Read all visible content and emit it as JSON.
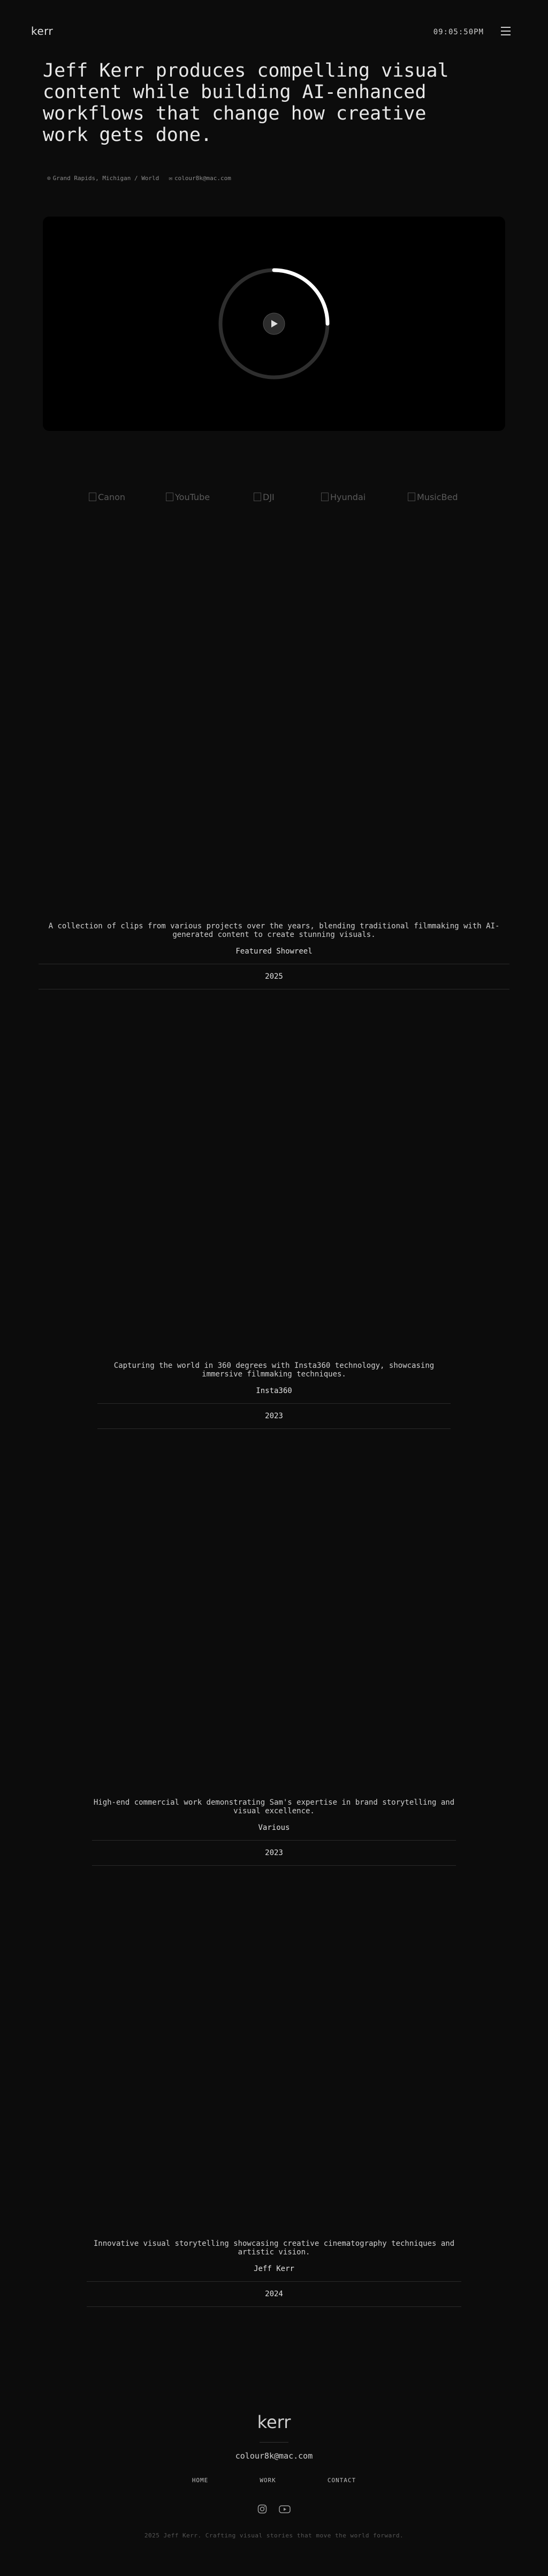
{
  "header": {
    "logo": "kerr",
    "clock": "09:05:50PM"
  },
  "hero": {
    "title": "Jeff Kerr produces compelling visual content while building AI-enhanced workflows that change how creative work gets done.",
    "location": "Grand Rapids, Michigan / World",
    "email": "colour8k@mac.com"
  },
  "video": {
    "progress": 0.25
  },
  "clients": [
    "Canon",
    "YouTube",
    "DJI",
    "Hyundai",
    "MusicBed"
  ],
  "projects": [
    {
      "description": "A collection of clips from various projects over the years, blending traditional filmmaking with AI-generated content to create stunning visuals.",
      "client": "Featured Showreel",
      "year": "2025"
    },
    {
      "description": "Capturing the world in 360 degrees with Insta360 technology, showcasing immersive filmmaking techniques.",
      "client": "Insta360",
      "year": "2023"
    },
    {
      "description": "High-end commercial work demonstrating Sam's expertise in brand storytelling and visual excellence.",
      "client": "Various",
      "year": "2023"
    },
    {
      "description": "Innovative visual storytelling showcasing creative cinematography techniques and artistic vision.",
      "client": "Jeff Kerr",
      "year": "2024"
    }
  ],
  "footer": {
    "logo": "kerr",
    "email": "colour8k@mac.com",
    "nav": [
      "HOME",
      "WORK",
      "CONTACT"
    ],
    "copyright": "2025 Jeff Kerr. Crafting visual stories that move the world forward."
  },
  "colors": {
    "background": "#0c0c0c",
    "text": "#d8d8d8"
  }
}
